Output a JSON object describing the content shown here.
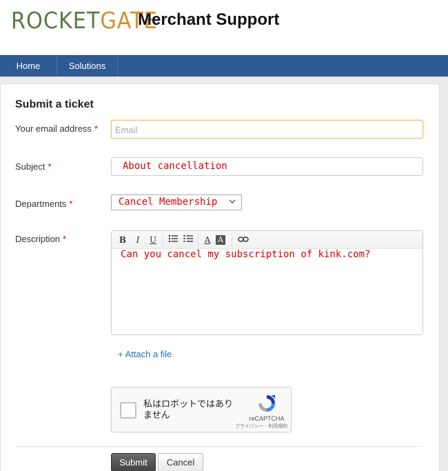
{
  "header": {
    "logo_part1": "ROCKET",
    "logo_part2": "GATE",
    "title": "Merchant Support"
  },
  "nav": {
    "home": "Home",
    "solutions": "Solutions"
  },
  "form": {
    "title": "Submit a ticket",
    "required_mark": "*",
    "email": {
      "label": "Your email address",
      "placeholder": "Email",
      "value": ""
    },
    "subject": {
      "label": "Subject",
      "value": "About cancellation"
    },
    "departments": {
      "label": "Departments",
      "selected": "Cancel Membership"
    },
    "description": {
      "label": "Description",
      "value": "Can you cancel my subscription of kink.com?",
      "toolbar": {
        "bold": "B",
        "italic": "I",
        "underline": "U",
        "text_color": "A",
        "bg_color": "A"
      }
    },
    "attach": "+ Attach a file",
    "captcha": {
      "text": "私はロボットではありません",
      "brand": "reCAPTCHA",
      "legal": "プライバシー - 利用規約"
    },
    "submit": "Submit",
    "cancel": "Cancel"
  },
  "colors": {
    "nav_bg": "#2f5b94",
    "logo_green": "#5a7a45",
    "logo_orange": "#d58e2f",
    "entered_text": "#dd0000",
    "link": "#2a6db0"
  }
}
